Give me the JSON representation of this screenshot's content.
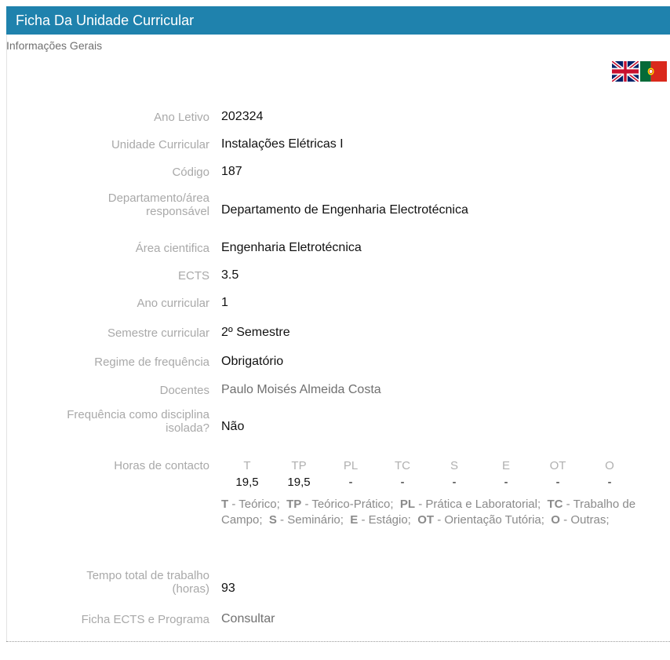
{
  "header": {
    "title": "Ficha Da Unidade Curricular"
  },
  "subheader": {
    "title": "Informações Gerais"
  },
  "flags": [
    "uk-flag-icon",
    "portugal-flag-icon"
  ],
  "fields": {
    "ano_letivo": {
      "label": "Ano Letivo",
      "value": "202324"
    },
    "unidade_curricular": {
      "label": "Unidade Curricular",
      "value": "Instalações Elétricas I"
    },
    "codigo": {
      "label": "Código",
      "value": "187"
    },
    "departamento": {
      "label_line1": "Departamento/área",
      "label_line2": "responsável",
      "value": "Departamento de Engenharia Electrotécnica"
    },
    "area_cientifica": {
      "label": "Área cientifica",
      "value": "Engenharia Eletrotécnica"
    },
    "ects": {
      "label": "ECTS",
      "value": "3.5"
    },
    "ano_curricular": {
      "label": "Ano curricular",
      "value": "1"
    },
    "semestre": {
      "label": "Semestre curricular",
      "value": "2º Semestre"
    },
    "regime": {
      "label": "Regime de frequência",
      "value": "Obrigatório"
    },
    "docentes": {
      "label": "Docentes",
      "value": "Paulo Moisés Almeida Costa"
    },
    "frequencia_isolada": {
      "label_line1": "Frequência como disciplina",
      "label_line2": "isolada?",
      "value": "Não"
    },
    "horas_contacto": {
      "label": "Horas de contacto"
    },
    "tempo_total": {
      "label_line1": "Tempo total de trabalho",
      "label_line2": "(horas)",
      "value": "93"
    },
    "ficha_ects": {
      "label": "Ficha ECTS e Programa",
      "value": "Consultar"
    }
  },
  "hours": {
    "headers": [
      "T",
      "TP",
      "PL",
      "TC",
      "S",
      "E",
      "OT",
      "O"
    ],
    "values": [
      "19,5",
      "19,5",
      "-",
      "-",
      "-",
      "-",
      "-",
      "-"
    ]
  },
  "legend": [
    {
      "code": "T",
      "desc": "Teórico;"
    },
    {
      "code": "TP",
      "desc": "Teórico-Prático;"
    },
    {
      "code": "PL",
      "desc": "Prática e Laboratorial;"
    },
    {
      "code": "TC",
      "desc": "Trabalho de Campo;"
    },
    {
      "code": "S",
      "desc": "Seminário;"
    },
    {
      "code": "E",
      "desc": "Estágio;"
    },
    {
      "code": "OT",
      "desc": "Orientação Tutória;"
    },
    {
      "code": "O",
      "desc": "Outras;"
    }
  ],
  "colors": {
    "header_bg": "#1f82ad",
    "label": "#a9a9a9",
    "value": "#111111",
    "muted_value": "#707070"
  }
}
